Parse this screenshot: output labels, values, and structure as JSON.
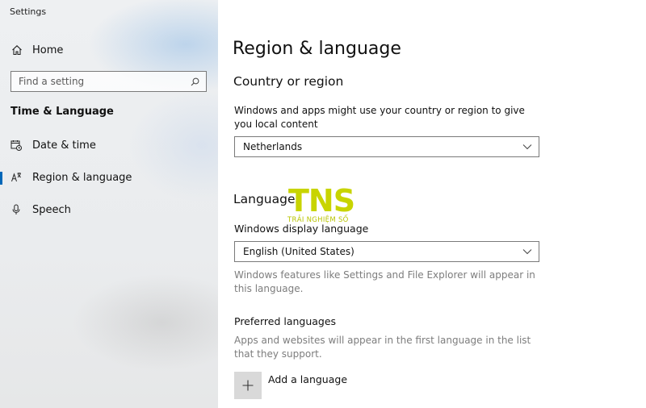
{
  "window": {
    "title": "Settings"
  },
  "sidebar": {
    "home_label": "Home",
    "search": {
      "placeholder": "Find a setting",
      "value": ""
    },
    "section_heading": "Time & Language",
    "items": [
      {
        "label": "Date & time",
        "icon": "calendar-clock-icon",
        "active": false
      },
      {
        "label": "Region & language",
        "icon": "region-language-icon",
        "active": true
      },
      {
        "label": "Speech",
        "icon": "microphone-icon",
        "active": false
      }
    ],
    "accent_color": "#0067b8"
  },
  "main": {
    "title": "Region & language",
    "country": {
      "heading": "Country or region",
      "description": "Windows and apps might use your country or region to give you local content",
      "selected": "Netherlands"
    },
    "languages": {
      "heading": "Languages",
      "display_language_label": "Windows display language",
      "display_language_selected": "English (United States)",
      "display_language_note": "Windows features like Settings and File Explorer will appear in this language.",
      "preferred_heading": "Preferred languages",
      "preferred_note": "Apps and websites will appear in the first language in the list that they support.",
      "add_label": "Add a language"
    }
  },
  "watermark": {
    "logo_text": "TNS",
    "tagline": "TRẢI NGHIỆM SỐ",
    "color": "#c8d400"
  }
}
